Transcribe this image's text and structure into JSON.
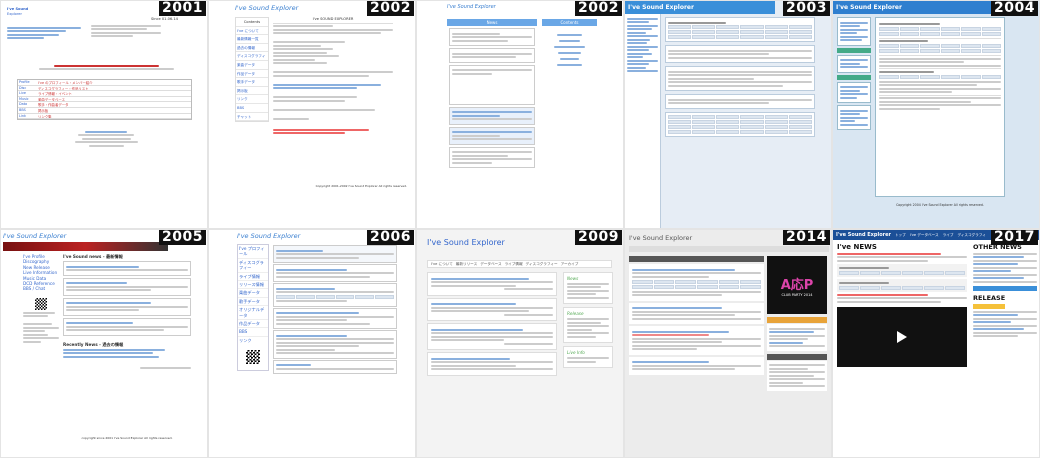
{
  "years": [
    "2001",
    "2002",
    "2002",
    "2003",
    "2004",
    "2005",
    "2006",
    "2009",
    "2014",
    "2017"
  ],
  "site_name": "I've Sound Explorer",
  "p2002a": {
    "nav_header": "Contents",
    "page_title": "I've SOUND EXPLORER",
    "footer_copyright": "Copyright 2001-2002 I've Sound Explorer All rights reserved."
  },
  "p2002b": {
    "col_news": "News",
    "col_contents": "Contents"
  },
  "p2003": {
    "header": "I've Sound Explorer"
  },
  "p2004": {
    "header": "I've Sound Explorer",
    "copyright": "Copyright 2004 I've Sound Explorer All rights reserved."
  },
  "p2005": {
    "header": "I've Sound Explorer",
    "nav": [
      "I've Profile",
      "Discography",
      "New Release",
      "Live Information",
      "Music Data",
      "DCD Reference",
      "BBS / Chat"
    ],
    "news_heading": "I've Sound news - 最新情報",
    "recently_heading": "Recently News - 過去の情報",
    "copyright": "copyright since 2001 I've Sound Explorer All rights reserved."
  },
  "p2006": {
    "header": "I've Sound Explorer",
    "nav": [
      "I've プロフィール",
      "ディスコグラフィー",
      "ライブ情報",
      "リリース情報",
      "楽曲データ",
      "歌手データ",
      "オリジナルデータ",
      "作品データ",
      "BBS",
      "リンク"
    ]
  },
  "p2009": {
    "header": "I've Sound Explorer",
    "tabs": [
      "I've について",
      "最新リリース",
      "データベース",
      "ライブ情報",
      "ディスコグラフィー",
      "アーカイブ"
    ],
    "side_labels": [
      "News",
      "Release",
      "Live Info"
    ]
  },
  "p2014": {
    "header": "I've Sound Explorer",
    "promo_title": "A応P",
    "promo_sub": "CLUB PARTY 2014"
  },
  "p2017": {
    "header": "I've Sound Explorer",
    "nav": [
      "トップ",
      "I've データベース",
      "ライブ",
      "ディスコグラフィ"
    ],
    "news": "I've NEWS",
    "other_news": "OTHER NEWS",
    "release": "RELEASE"
  }
}
